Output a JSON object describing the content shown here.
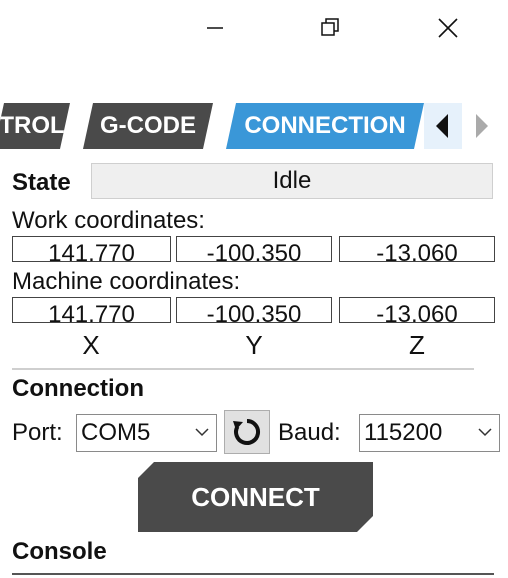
{
  "window": {
    "minimize_icon": "minimize-icon",
    "maximize_icon": "restore-icon",
    "close_icon": "close-icon"
  },
  "tabs": [
    {
      "label": "TROL"
    },
    {
      "label": "G-CODE"
    },
    {
      "label": "CONNECTION",
      "active": true
    }
  ],
  "state": {
    "label": "State",
    "value": "Idle"
  },
  "work_coordinates": {
    "label": "Work coordinates:",
    "x": "141.770",
    "y": "-100.350",
    "z": "-13.060"
  },
  "machine_coordinates": {
    "label": "Machine coordinates:",
    "x": "141.770",
    "y": "-100.350",
    "z": "-13.060"
  },
  "axes": [
    "X",
    "Y",
    "Z"
  ],
  "connection": {
    "heading": "Connection",
    "port_label": "Port:",
    "port_value": "COM5",
    "baud_label": "Baud:",
    "baud_value": "115200",
    "connect_label": "CONNECT"
  },
  "console": {
    "heading": "Console"
  },
  "colors": {
    "accent": "#3a97d8",
    "dark": "#4a4a4a"
  }
}
